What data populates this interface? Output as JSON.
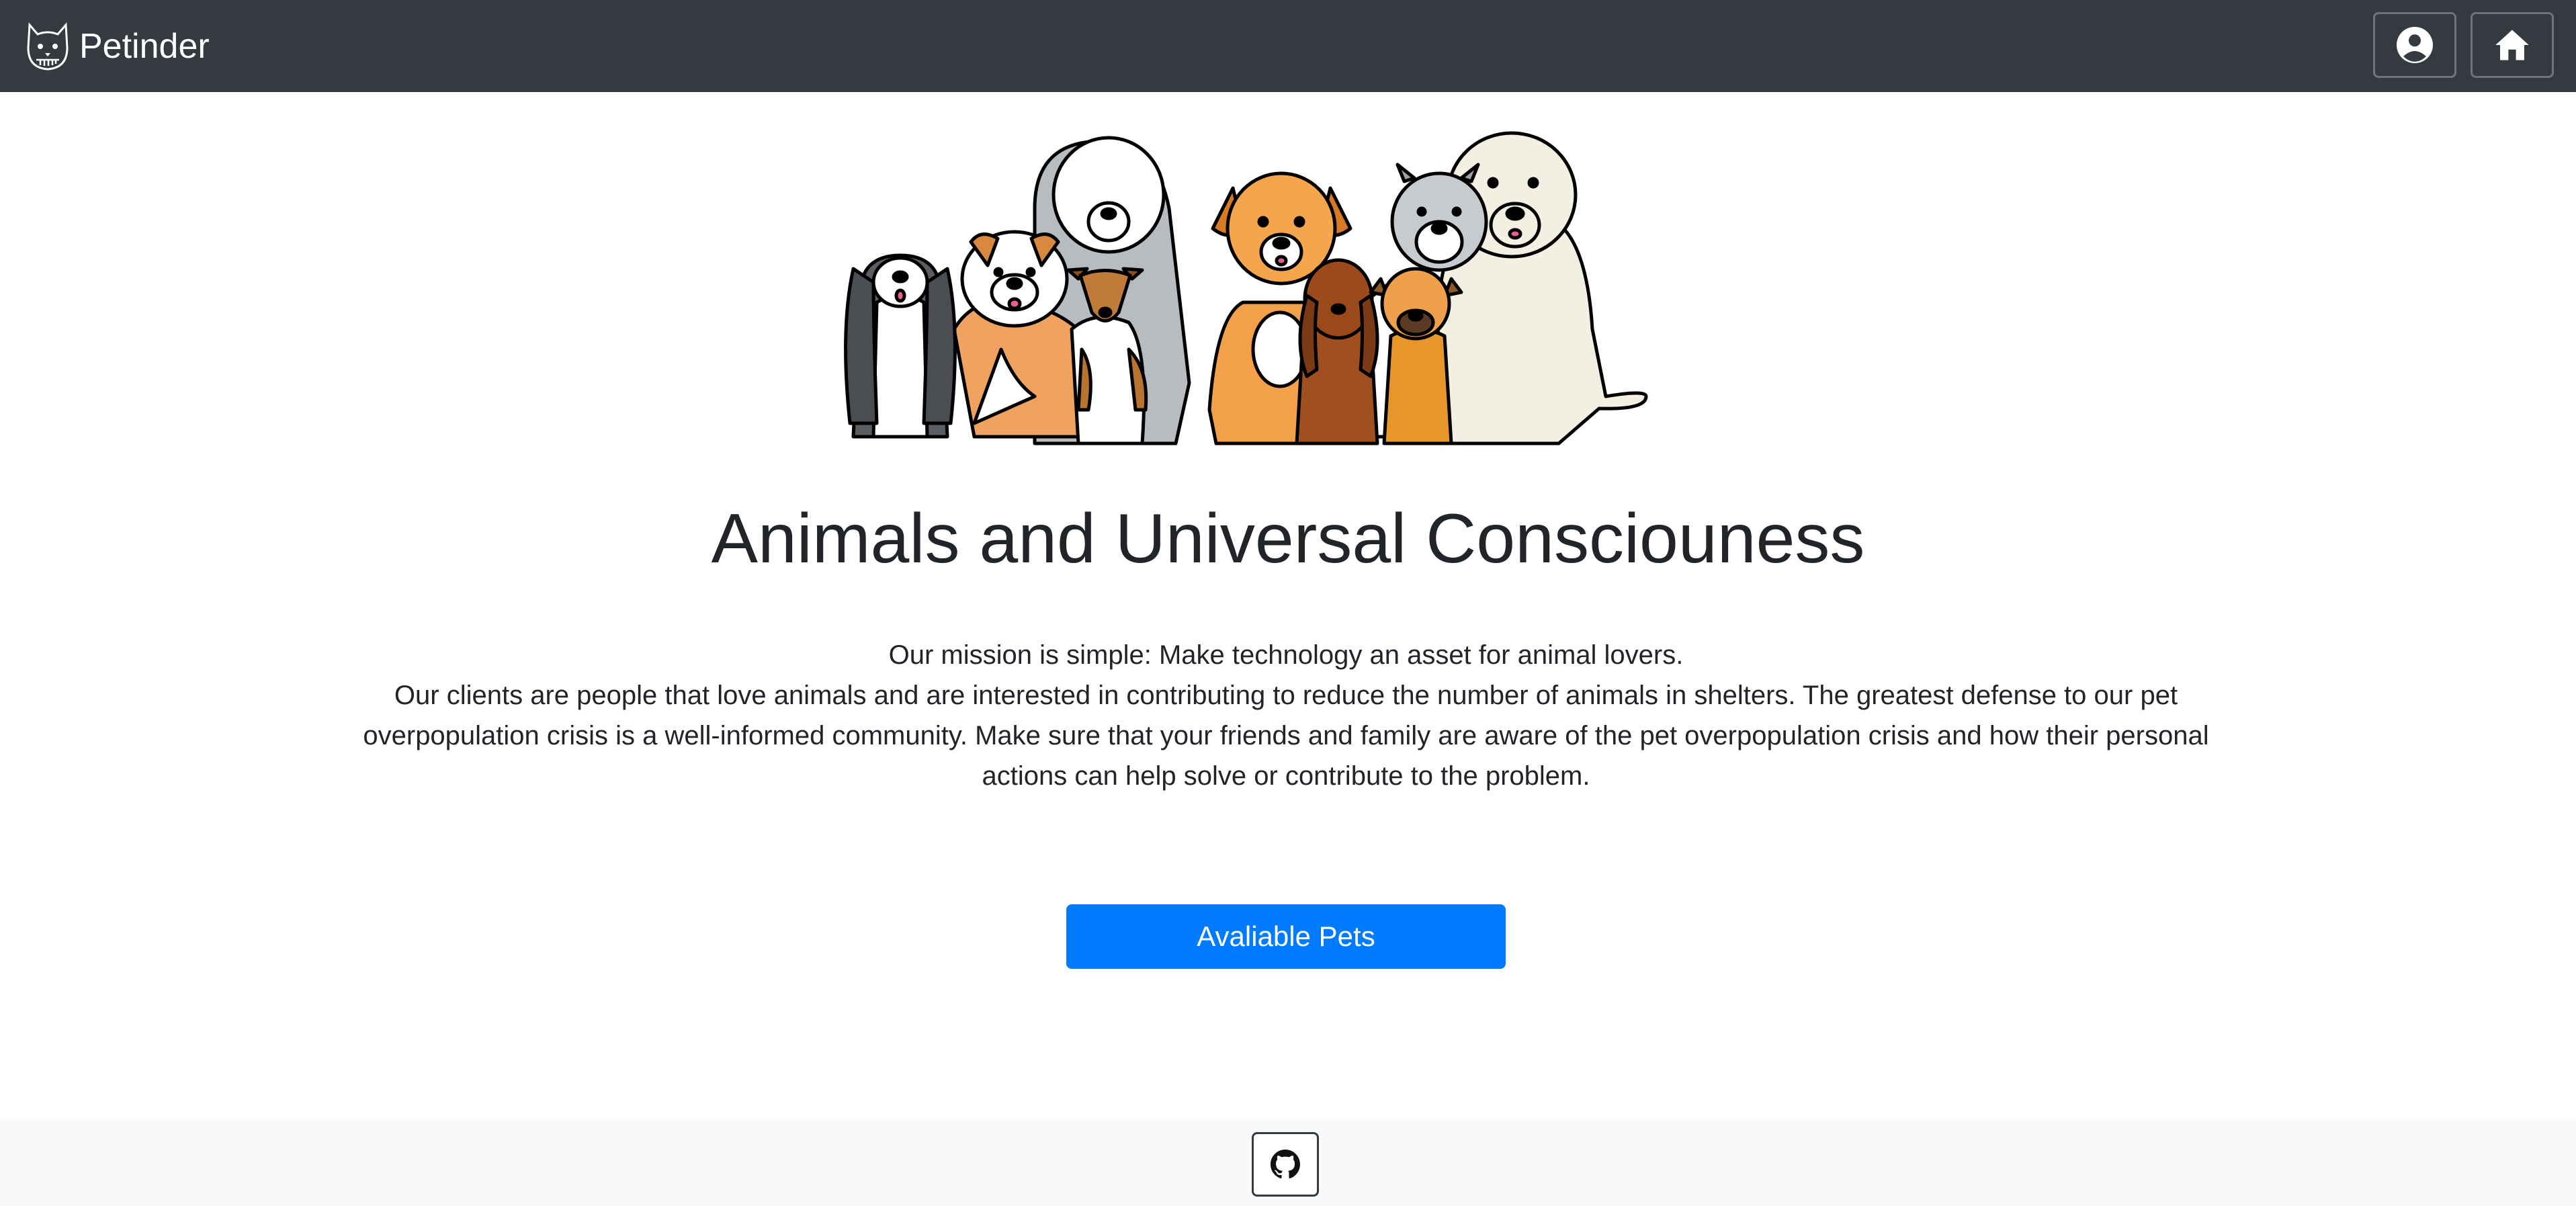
{
  "navbar": {
    "brand_name": "Petinder",
    "brand_logo_icon": "cat-face-logo-icon",
    "background": "#343a40",
    "user_button_icon": "user-circle-icon",
    "home_button_icon": "home-icon"
  },
  "hero": {
    "illustration": "group-of-cartoon-dogs",
    "title": "Animals and Universal Consciouness",
    "mission": "Our mission is simple: Make technology an asset for animal lovers.",
    "description": "Our clients are people that love animals and are interested in contributing to reduce the number of animals in shelters. The greatest defense to our pet overpopulation crisis is a well-informed community. Make sure that your friends and family are aware of the pet overpopulation crisis and how their personal actions can help solve or contribute to the problem."
  },
  "cta": {
    "label": "Avaliable Pets",
    "color": "#007bff"
  },
  "footer": {
    "github_icon": "github-icon",
    "background": "#f8f9fa"
  }
}
